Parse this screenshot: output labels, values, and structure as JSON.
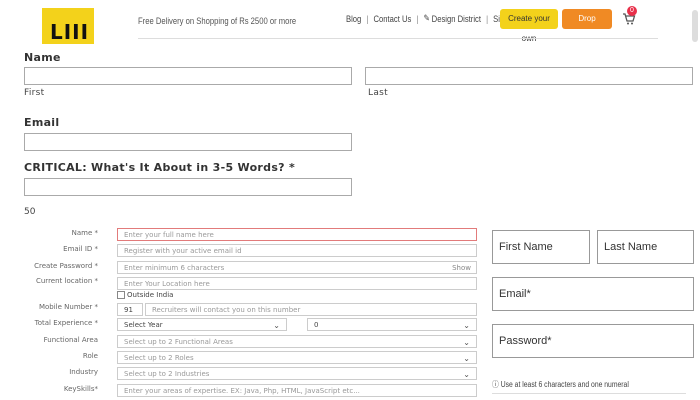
{
  "header": {
    "logo_text": "LIII",
    "tagline": "Free Delivery on Shopping of Rs 2500 or more",
    "nav": [
      "Blog",
      "Contact Us",
      "Design District",
      "Signup"
    ],
    "create_button": "Create your own",
    "complaint_button": "Drop Complaint",
    "cart_count": "0"
  },
  "top_form": {
    "name_label": "Name",
    "first_label": "First",
    "last_label": "Last",
    "email_label": "Email",
    "critical_label": "CRITICAL: What's It About in 3-5 Words? *",
    "char_count": "50"
  },
  "reg_form": {
    "name": {
      "label": "Name *",
      "placeholder": "Enter your full name here"
    },
    "email": {
      "label": "Email ID *",
      "placeholder": "Register with your active email id"
    },
    "password": {
      "label": "Create Password *",
      "placeholder": "Enter minimum 6 characters",
      "show": "Show"
    },
    "location": {
      "label": "Current location *",
      "placeholder": "Enter Your Location here"
    },
    "outside_india": "Outside India",
    "mobile": {
      "label": "Mobile Number *",
      "code": "91",
      "placeholder": "Recruiters will contact you on this number"
    },
    "experience": {
      "label": "Total Experience *",
      "year": "Select Year",
      "month": "0"
    },
    "functional_area": {
      "label": "Functional Area",
      "placeholder": "Select up to 2 Functional Areas"
    },
    "role": {
      "label": "Role",
      "placeholder": "Select up to 2 Roles"
    },
    "industry": {
      "label": "Industry",
      "placeholder": "Select up to 2 Industries"
    },
    "keyskills": {
      "label": "KeySkills*",
      "placeholder": "Enter your areas of expertise. EX: Java, Php, HTML, JavaScript etc..."
    }
  },
  "right_form": {
    "first_name": "First Name",
    "last_name": "Last Name",
    "email": "Email*",
    "password": "Password*",
    "note": "Use at least 6 characters and one numeral"
  },
  "colors": {
    "yellow": "#f3d21b",
    "orange": "#f08a24",
    "badge": "#e8304a"
  }
}
